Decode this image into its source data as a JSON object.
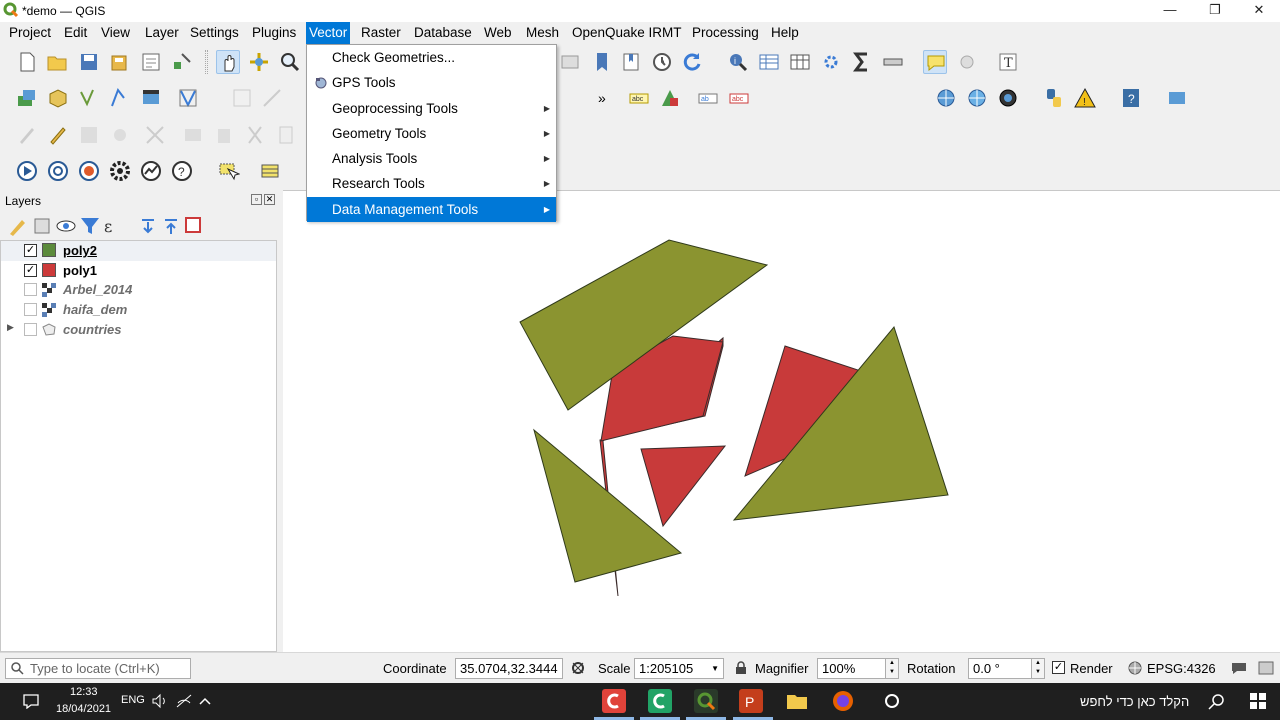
{
  "window": {
    "title": "*demo — QGIS",
    "minimize": "—",
    "restore": "❐",
    "close": "✕"
  },
  "menubar": [
    "Project",
    "Edit",
    "View",
    "Layer",
    "Settings",
    "Plugins",
    "Vector",
    "Raster",
    "Database",
    "Web",
    "Mesh",
    "OpenQuake IRMT",
    "Processing",
    "Help"
  ],
  "vector_menu": {
    "items": [
      {
        "label": "Check Geometries...",
        "submenu": false
      },
      {
        "label": "GPS Tools",
        "submenu": false,
        "icon": "gps-icon"
      },
      {
        "label": "Geoprocessing Tools",
        "submenu": true
      },
      {
        "label": "Geometry Tools",
        "submenu": true
      },
      {
        "label": "Analysis Tools",
        "submenu": true
      },
      {
        "label": "Research Tools",
        "submenu": true
      },
      {
        "label": "Data Management Tools",
        "submenu": true,
        "highlighted": true
      }
    ],
    "arrow": "▶"
  },
  "toolbar": {
    "overflow": "»"
  },
  "layers_panel": {
    "title": "Layers",
    "float_btn": "▫",
    "close_btn": "✕",
    "layers": [
      {
        "name": "poly2",
        "checked": true,
        "color": "#5a8a3c",
        "type": "vector",
        "selected": true
      },
      {
        "name": "poly1",
        "checked": true,
        "color": "#cc3a3a",
        "type": "vector"
      },
      {
        "name": "Arbel_2014",
        "checked": false,
        "type": "raster"
      },
      {
        "name": "haifa_dem",
        "checked": false,
        "type": "raster"
      },
      {
        "name": "countries",
        "checked": false,
        "type": "group"
      }
    ],
    "check": "✓",
    "expand": "▶"
  },
  "colors": {
    "accent": "#0078d7",
    "poly2_fill": "#8b9430",
    "poly1_fill": "#c83a3a"
  },
  "statusbar": {
    "locator_placeholder": "Type to locate (Ctrl+K)",
    "coordinate_label": "Coordinate",
    "coordinate": "35.0704,32.3444",
    "scale_label": "Scale",
    "scale": "1:205105",
    "magnifier_label": "Magnifier",
    "magnifier": "100%",
    "rotation_label": "Rotation",
    "rotation": "0.0 °",
    "render_label": "Render",
    "render_checked": "✓",
    "crs": "EPSG:4326"
  },
  "taskbar": {
    "time": "12:33",
    "date": "18/04/2021",
    "lang": "ENG",
    "search_placeholder": "הקלד כאן כדי לחפש"
  }
}
